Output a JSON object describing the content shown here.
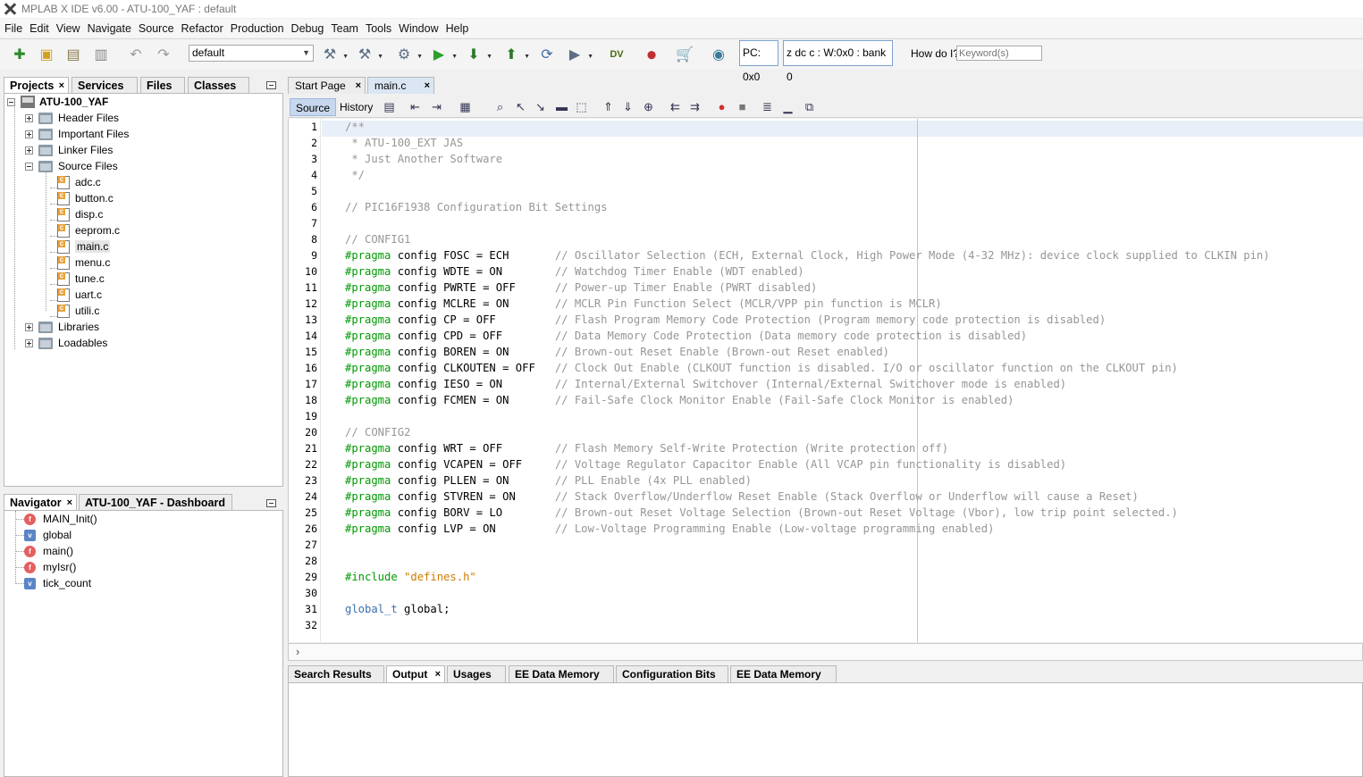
{
  "window": {
    "title": "MPLAB X IDE v6.00 - ATU-100_YAF : default"
  },
  "menu": [
    "File",
    "Edit",
    "View",
    "Navigate",
    "Source",
    "Refactor",
    "Production",
    "Debug",
    "Team",
    "Tools",
    "Window",
    "Help"
  ],
  "toolbar": {
    "configuration": "default",
    "pc": "PC: 0x0",
    "status_bits": "z dc c  : W:0x0 : bank 0",
    "howdoi_label": "How do I?",
    "keyword_placeholder": "Keyword(s)",
    "icons": [
      "new-file-icon",
      "new-project-icon",
      "open-project-icon",
      "close-project-icon",
      "undo-icon",
      "redo-icon",
      "build-project-icon",
      "clean-build-icon",
      "make-icon",
      "run-project-icon",
      "debug-project-icon",
      "program-device-icon",
      "read-device-icon",
      "hold-in-reset-icon",
      "data-visualizer-icon",
      "microchip-discover-icon",
      "shop-icon",
      "community-icon"
    ]
  },
  "projects_panel": {
    "tabs": [
      "Projects",
      "Services",
      "Files",
      "Classes"
    ],
    "project": "ATU-100_YAF",
    "folders": [
      "Header Files",
      "Important Files",
      "Linker Files",
      "Source Files",
      "Libraries",
      "Loadables"
    ],
    "source_files": [
      "adc.c",
      "button.c",
      "disp.c",
      "eeprom.c",
      "main.c",
      "menu.c",
      "tune.c",
      "uart.c",
      "utili.c"
    ],
    "selected_file": "main.c"
  },
  "navigator": {
    "tabs": [
      "Navigator",
      "ATU-100_YAF - Dashboard"
    ],
    "items": [
      {
        "label": "MAIN_Init()",
        "kind": "function"
      },
      {
        "label": "global",
        "kind": "variable"
      },
      {
        "label": "main()",
        "kind": "function"
      },
      {
        "label": "myIsr()",
        "kind": "function"
      },
      {
        "label": "tick_count",
        "kind": "variable"
      }
    ]
  },
  "editor": {
    "tabs": [
      "Start Page",
      "main.c"
    ],
    "active_tab": "main.c",
    "modes": [
      "Source",
      "History"
    ],
    "active_mode": "Source",
    "lines": [
      {
        "n": "1",
        "segs": [
          {
            "t": "/**",
            "c": "cmt"
          }
        ]
      },
      {
        "n": "2",
        "segs": [
          {
            "t": " * ATU-100_EXT JAS",
            "c": "cmt"
          }
        ]
      },
      {
        "n": "3",
        "segs": [
          {
            "t": " * Just Another Software",
            "c": "cmt"
          }
        ]
      },
      {
        "n": "4",
        "segs": [
          {
            "t": " */",
            "c": "cmt"
          }
        ]
      },
      {
        "n": "5",
        "segs": []
      },
      {
        "n": "6",
        "segs": [
          {
            "t": "// PIC16F1938 Configuration Bit Settings",
            "c": "cmt"
          }
        ]
      },
      {
        "n": "7",
        "segs": []
      },
      {
        "n": "8",
        "segs": [
          {
            "t": "// CONFIG1",
            "c": "cmt"
          }
        ]
      },
      {
        "n": "9",
        "segs": [
          {
            "t": "#pragma",
            "c": "pp"
          },
          {
            "t": " config FOSC = ECH       ",
            "c": ""
          },
          {
            "t": "// Oscillator Selection (ECH, External Clock, High Power Mode (4-32 MHz): device clock supplied to CLKIN pin)",
            "c": "cmt"
          }
        ]
      },
      {
        "n": "10",
        "segs": [
          {
            "t": "#pragma",
            "c": "pp"
          },
          {
            "t": " config WDTE = ON        ",
            "c": ""
          },
          {
            "t": "// Watchdog Timer Enable (WDT enabled)",
            "c": "cmt"
          }
        ]
      },
      {
        "n": "11",
        "segs": [
          {
            "t": "#pragma",
            "c": "pp"
          },
          {
            "t": " config PWRTE = OFF      ",
            "c": ""
          },
          {
            "t": "// Power-up Timer Enable (PWRT disabled)",
            "c": "cmt"
          }
        ]
      },
      {
        "n": "12",
        "segs": [
          {
            "t": "#pragma",
            "c": "pp"
          },
          {
            "t": " config MCLRE = ON       ",
            "c": ""
          },
          {
            "t": "// MCLR Pin Function Select (MCLR/VPP pin function is MCLR)",
            "c": "cmt"
          }
        ]
      },
      {
        "n": "13",
        "segs": [
          {
            "t": "#pragma",
            "c": "pp"
          },
          {
            "t": " config CP = OFF         ",
            "c": ""
          },
          {
            "t": "// Flash Program Memory Code Protection (Program memory code protection is disabled)",
            "c": "cmt"
          }
        ]
      },
      {
        "n": "14",
        "segs": [
          {
            "t": "#pragma",
            "c": "pp"
          },
          {
            "t": " config CPD = OFF        ",
            "c": ""
          },
          {
            "t": "// Data Memory Code Protection (Data memory code protection is disabled)",
            "c": "cmt"
          }
        ]
      },
      {
        "n": "15",
        "segs": [
          {
            "t": "#pragma",
            "c": "pp"
          },
          {
            "t": " config BOREN = ON       ",
            "c": ""
          },
          {
            "t": "// Brown-out Reset Enable (Brown-out Reset enabled)",
            "c": "cmt"
          }
        ]
      },
      {
        "n": "16",
        "segs": [
          {
            "t": "#pragma",
            "c": "pp"
          },
          {
            "t": " config CLKOUTEN = OFF   ",
            "c": ""
          },
          {
            "t": "// Clock Out Enable (CLKOUT function is disabled. I/O or oscillator function on the CLKOUT pin)",
            "c": "cmt"
          }
        ]
      },
      {
        "n": "17",
        "segs": [
          {
            "t": "#pragma",
            "c": "pp"
          },
          {
            "t": " config IESO = ON        ",
            "c": ""
          },
          {
            "t": "// Internal/External Switchover (Internal/External Switchover mode is enabled)",
            "c": "cmt"
          }
        ]
      },
      {
        "n": "18",
        "segs": [
          {
            "t": "#pragma",
            "c": "pp"
          },
          {
            "t": " config FCMEN = ON       ",
            "c": ""
          },
          {
            "t": "// Fail-Safe Clock Monitor Enable (Fail-Safe Clock Monitor is enabled)",
            "c": "cmt"
          }
        ]
      },
      {
        "n": "19",
        "segs": []
      },
      {
        "n": "20",
        "segs": [
          {
            "t": "// CONFIG2",
            "c": "cmt"
          }
        ]
      },
      {
        "n": "21",
        "segs": [
          {
            "t": "#pragma",
            "c": "pp"
          },
          {
            "t": " config WRT = OFF        ",
            "c": ""
          },
          {
            "t": "// Flash Memory Self-Write Protection (Write protection off)",
            "c": "cmt"
          }
        ]
      },
      {
        "n": "22",
        "segs": [
          {
            "t": "#pragma",
            "c": "pp"
          },
          {
            "t": " config VCAPEN = OFF     ",
            "c": ""
          },
          {
            "t": "// Voltage Regulator Capacitor Enable (All VCAP pin functionality is disabled)",
            "c": "cmt"
          }
        ]
      },
      {
        "n": "23",
        "segs": [
          {
            "t": "#pragma",
            "c": "pp"
          },
          {
            "t": " config PLLEN = ON       ",
            "c": ""
          },
          {
            "t": "// PLL Enable (4x PLL enabled)",
            "c": "cmt"
          }
        ]
      },
      {
        "n": "24",
        "segs": [
          {
            "t": "#pragma",
            "c": "pp"
          },
          {
            "t": " config STVREN = ON      ",
            "c": ""
          },
          {
            "t": "// Stack Overflow/Underflow Reset Enable (Stack Overflow or Underflow will cause a Reset)",
            "c": "cmt"
          }
        ]
      },
      {
        "n": "25",
        "segs": [
          {
            "t": "#pragma",
            "c": "pp"
          },
          {
            "t": " config BORV = LO        ",
            "c": ""
          },
          {
            "t": "// Brown-out Reset Voltage Selection (Brown-out Reset Voltage (Vbor), low trip point selected.)",
            "c": "cmt"
          }
        ]
      },
      {
        "n": "26",
        "segs": [
          {
            "t": "#pragma",
            "c": "pp"
          },
          {
            "t": " config LVP = ON         ",
            "c": ""
          },
          {
            "t": "// Low-Voltage Programming Enable (Low-voltage programming enabled)",
            "c": "cmt"
          }
        ]
      },
      {
        "n": "27",
        "segs": []
      },
      {
        "n": "28",
        "segs": []
      },
      {
        "n": "29",
        "segs": [
          {
            "t": "#include",
            "c": "pp"
          },
          {
            "t": " ",
            "c": ""
          },
          {
            "t": "\"defines.h\"",
            "c": "str"
          }
        ]
      },
      {
        "n": "30",
        "segs": []
      },
      {
        "n": "31",
        "segs": [
          {
            "t": "global_t",
            "c": "typ"
          },
          {
            "t": " global;",
            "c": ""
          }
        ]
      },
      {
        "n": "32",
        "segs": []
      }
    ]
  },
  "output_panel": {
    "tabs": [
      "Search Results",
      "Output",
      "Usages",
      "EE Data Memory",
      "Configuration Bits",
      "EE Data Memory"
    ],
    "active_tab": "Output"
  }
}
